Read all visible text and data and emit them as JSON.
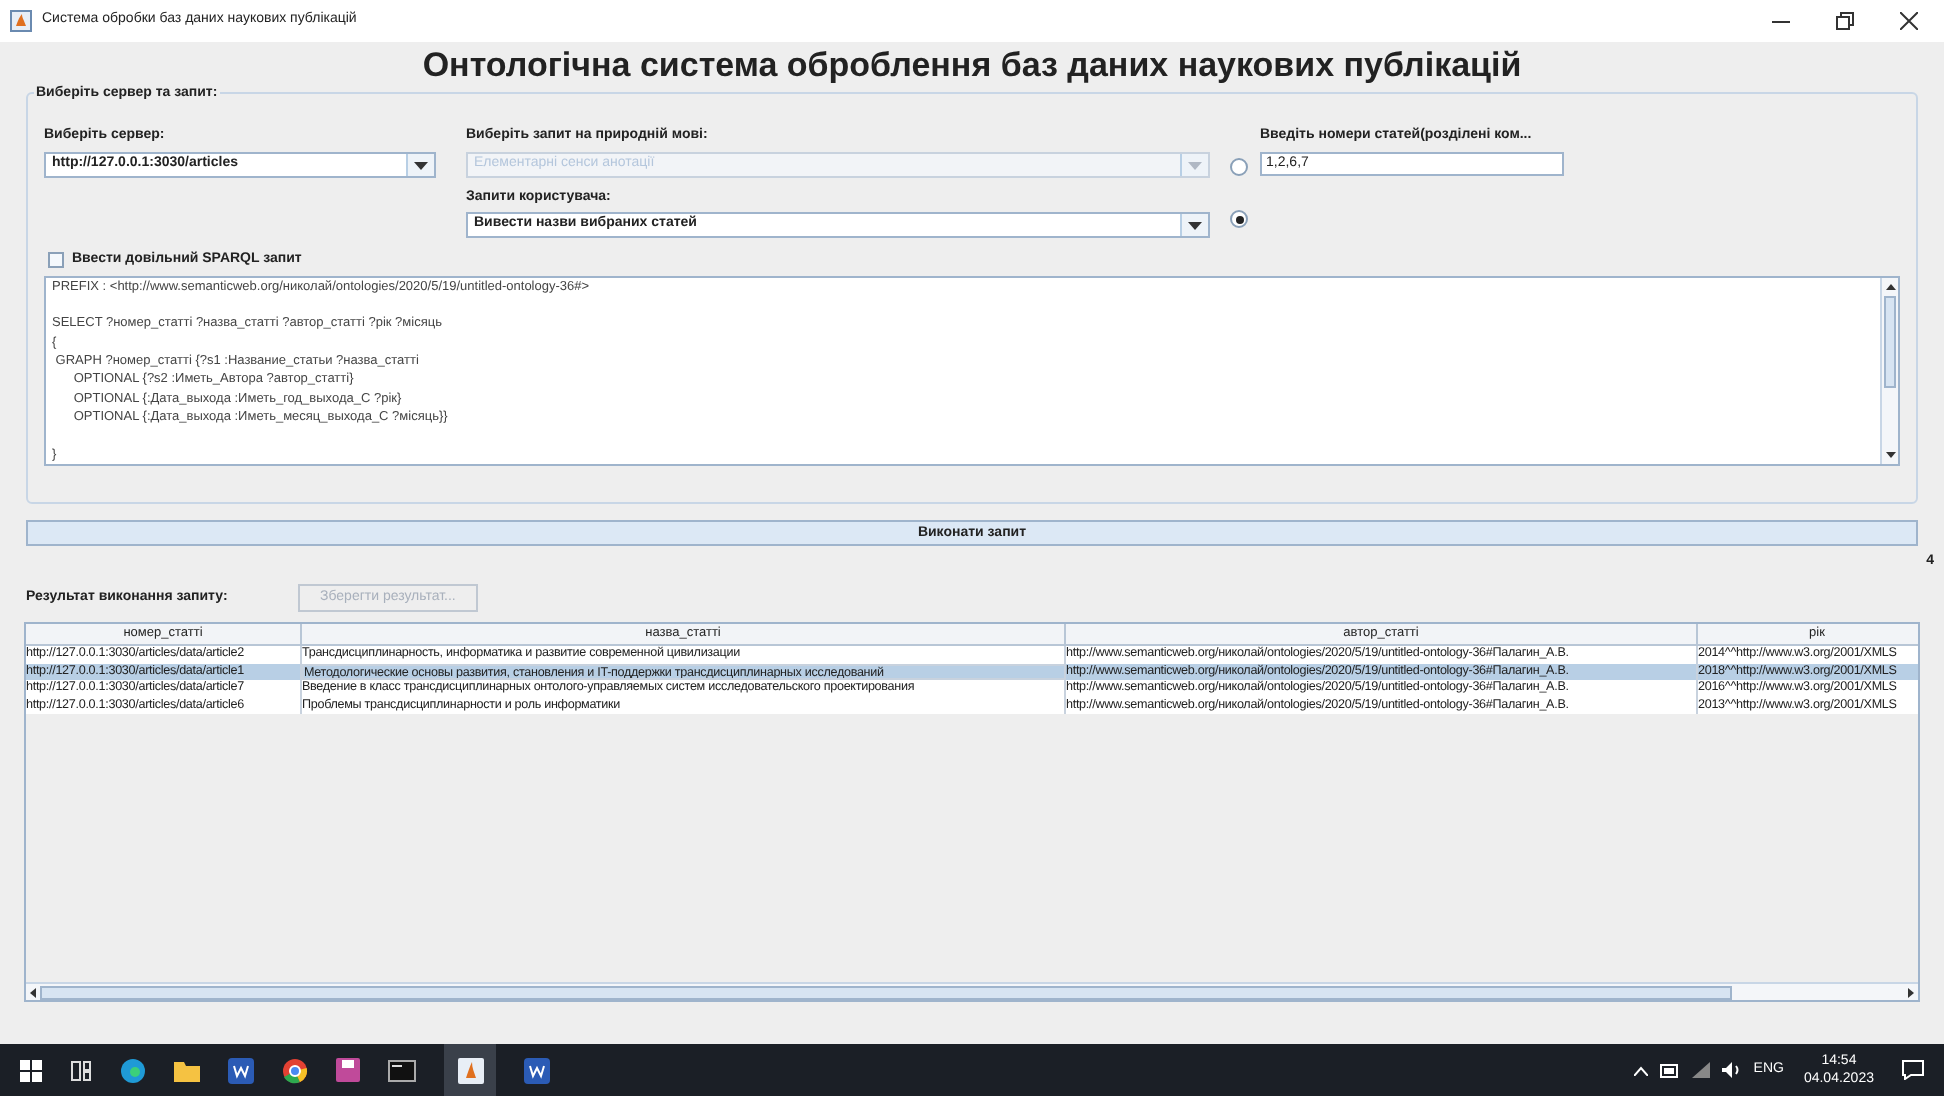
{
  "window": {
    "title": "Система обробки баз даних наукових публікацій"
  },
  "heading": "Онтологічна система оброблення баз даних наукових публікацій",
  "group": {
    "title": "Виберіть сервер та запит:",
    "server": {
      "label": "Виберіть сервер:",
      "value": "http://127.0.0.1:3030/articles"
    },
    "nl_query": {
      "label": "Виберіть запит на природній мові:",
      "value": "Елементарні сенси анотації",
      "disabled": true,
      "selected": false
    },
    "numbers": {
      "label": "Введіть номери статей(розділені ком...",
      "value": "1,2,6,7"
    },
    "user_query": {
      "label": "Запити користувача:",
      "value": "Вивести назви вибраних статей",
      "selected": true
    },
    "sparql_checkbox": {
      "label": "Ввести довільний SPARQL запит",
      "checked": false
    },
    "query_text": [
      {
        "text": "PREFIX : <http://www.semanticweb.org/николай/ontologies/2020/5/19/untitled-ontology-36#>",
        "blank_line_before": false
      },
      {
        "text": "SELECT ?номер_статті ?назва_статті ?автор_статті ?рік ?місяць",
        "blank_line_before": true
      },
      {
        "text": "{",
        "blank_line_before": false
      },
      {
        "text": " GRAPH ?номер_статті {?s1 :Название_статьи ?назва_статті",
        "blank_line_before": false
      },
      {
        "text": "      OPTIONAL {?s2 :Иметь_Автора ?автор_статті}",
        "blank_line_before": false
      },
      {
        "text": "      OPTIONAL {:Дата_выхода :Иметь_год_выхода_С ?рік}",
        "blank_line_before": false
      },
      {
        "text": "      OPTIONAL {:Дата_выхода :Иметь_месяц_выхода_С ?місяць}}",
        "blank_line_before": false
      },
      {
        "text": "}",
        "blank_line_before": true
      }
    ]
  },
  "execute_button": "Виконати запит",
  "result_count": "4",
  "result_label": "Результат виконання запиту:",
  "save_button": {
    "label": "Зберегти результат...",
    "disabled": true
  },
  "table": {
    "columns": [
      "номер_статті",
      "назва_статті",
      "автор_статті",
      "рік"
    ],
    "rows": [
      {
        "selected": false,
        "cells": [
          "http://127.0.0.1:3030/articles/data/article2",
          "Трансдисциплинарность, информатика и развитие современной цивилизации",
          "http://www.semanticweb.org/николай/ontologies/2020/5/19/untitled-ontology-36#Палагин_А.В.",
          "2014^^http://www.w3.org/2001/XMLS"
        ]
      },
      {
        "selected": true,
        "cells": [
          "http://127.0.0.1:3030/articles/data/article1",
          "Методологические основы развития, становления и IT-поддержки трансдисциплинарных исследований",
          "http://www.semanticweb.org/николай/ontologies/2020/5/19/untitled-ontology-36#Палагин_А.В.",
          "2018^^http://www.w3.org/2001/XMLS"
        ]
      },
      {
        "selected": false,
        "cells": [
          "http://127.0.0.1:3030/articles/data/article7",
          "Введение в класс трансдисциплинарных онтолого-управляемых систем исследовательского проектирования",
          "http://www.semanticweb.org/николай/ontologies/2020/5/19/untitled-ontology-36#Палагин_А.В.",
          "2016^^http://www.w3.org/2001/XMLS"
        ]
      },
      {
        "selected": false,
        "cells": [
          "http://127.0.0.1:3030/articles/data/article6",
          "Проблемы трансдисциплинарности  и роль информатики",
          "http://www.semanticweb.org/николай/ontologies/2020/5/19/untitled-ontology-36#Палагин_А.В.",
          "2013^^http://www.w3.org/2001/XMLS"
        ]
      }
    ]
  },
  "taskbar": {
    "language": "ENG",
    "time": "14:54",
    "date": "04.04.2023"
  }
}
